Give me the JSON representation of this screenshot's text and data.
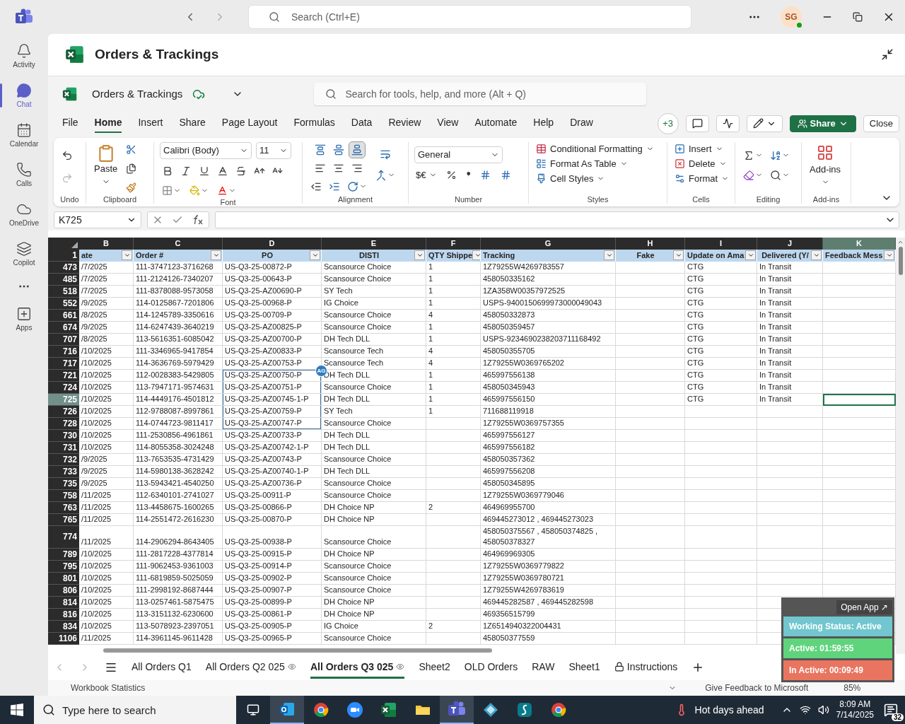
{
  "teams": {
    "search": {
      "placeholder": "Search (Ctrl+E)"
    },
    "avatar": "SG",
    "rail": [
      {
        "label": "Activity",
        "selected": false
      },
      {
        "label": "Chat",
        "selected": true
      },
      {
        "label": "Calendar",
        "selected": false
      },
      {
        "label": "Calls",
        "selected": false
      },
      {
        "label": "OneDrive",
        "selected": false
      },
      {
        "label": "Copilot",
        "selected": false
      },
      {
        "label": "Apps",
        "selected": false
      }
    ]
  },
  "app_title": "Orders & Trackings",
  "workbook": {
    "name": "Orders & Trackings",
    "search": {
      "placeholder": "Search for tools, help, and more (Alt + Q)"
    }
  },
  "menu": [
    {
      "label": "File",
      "selected": false
    },
    {
      "label": "Home",
      "selected": true
    },
    {
      "label": "Insert",
      "selected": false
    },
    {
      "label": "Share",
      "selected": false
    },
    {
      "label": "Page Layout",
      "selected": false
    },
    {
      "label": "Formulas",
      "selected": false
    },
    {
      "label": "Data",
      "selected": false
    },
    {
      "label": "Review",
      "selected": false
    },
    {
      "label": "View",
      "selected": false
    },
    {
      "label": "Automate",
      "selected": false
    },
    {
      "label": "Help",
      "selected": false
    },
    {
      "label": "Draw",
      "selected": false
    }
  ],
  "collaborators_count": "+3",
  "share": "Share",
  "close": "Close",
  "ribbon": {
    "groups": [
      "Undo",
      "Clipboard",
      "Font",
      "Alignment",
      "Number",
      "Styles",
      "Cells",
      "Editing",
      "Add-ins"
    ],
    "paste": "Paste",
    "font": "Calibri (Body)",
    "size": "11",
    "number_format": "General",
    "currency": "$€",
    "styles": [
      "Conditional Formatting",
      "Format As Table",
      "Cell Styles"
    ],
    "cells": [
      "Insert",
      "Delete",
      "Format"
    ],
    "addins": "Add-ins"
  },
  "name_box": "K725",
  "columns": [
    {
      "letter": "B",
      "title": "ate",
      "selected": false
    },
    {
      "letter": "C",
      "title": "Order #",
      "selected": false
    },
    {
      "letter": "D",
      "title": "PO",
      "selected": false
    },
    {
      "letter": "E",
      "title": "DISTI",
      "selected": false
    },
    {
      "letter": "F",
      "title": "QTY Shippe",
      "selected": false
    },
    {
      "letter": "G",
      "title": "Tracking",
      "selected": false
    },
    {
      "letter": "H",
      "title": "Fake",
      "selected": false
    },
    {
      "letter": "I",
      "title": "Update on Ama",
      "selected": false
    },
    {
      "letter": "J",
      "title": "Delivered (Y/",
      "selected": false
    },
    {
      "letter": "K",
      "title": "Feedback Mess",
      "selected": true
    }
  ],
  "header_row": "1",
  "collaborator": {
    "initials": "AG"
  },
  "rows": [
    {
      "row": "473",
      "date": "/7/2025",
      "order": "111-3747123-3716268",
      "po": "US-Q3-25-00872-P",
      "disti": "Scansource Choice",
      "qty": "1",
      "tracking": "1Z79255W4269783557",
      "update": "CTG",
      "delivered": "In Transit",
      "selected": false,
      "po_marked": false
    },
    {
      "row": "485",
      "date": "/7/2025",
      "order": "111-2124126-7340207",
      "po": "US-Q3-25-00643-P",
      "disti": "Scansource Choice",
      "qty": "1",
      "tracking": "458050335162",
      "update": "CTG",
      "delivered": "In Transit",
      "selected": false,
      "po_marked": false
    },
    {
      "row": "518",
      "date": "/7/2025",
      "order": "111-8378088-9573058",
      "po": "US-Q3-25-AZ00690-P",
      "disti": "SY Tech",
      "qty": "1",
      "tracking": "1ZA358W00357972525",
      "update": "CTG",
      "delivered": "In Transit",
      "selected": false,
      "po_marked": false
    },
    {
      "row": "552",
      "date": "/9/2025",
      "order": "114-0125867-7201806",
      "po": "US-Q3-25-00968-P",
      "disti": "IG Choice",
      "qty": "1",
      "tracking": "USPS-9400150699973000049043",
      "update": "CTG",
      "delivered": "In Transit",
      "selected": false,
      "po_marked": false
    },
    {
      "row": "661",
      "date": "/8/2025",
      "order": "114-1245789-3350616",
      "po": "US-Q3-25-00709-P",
      "disti": "Scansource Choice",
      "qty": "4",
      "tracking": "458050332873",
      "update": "CTG",
      "delivered": "In Transit",
      "selected": false,
      "po_marked": false
    },
    {
      "row": "674",
      "date": "/9/2025",
      "order": "114-6247439-3640219",
      "po": "US-Q3-25-AZ00825-P",
      "disti": "Scansource Choice",
      "qty": "1",
      "tracking": "458050359457",
      "update": "CTG",
      "delivered": "In Transit",
      "selected": false,
      "po_marked": false
    },
    {
      "row": "707",
      "date": "/8/2025",
      "order": "113-5616351-6085042",
      "po": "US-Q3-25-AZ00700-P",
      "disti": "DH Tech DLL",
      "qty": "1",
      "tracking": "USPS-9234690238203711168492",
      "update": "CTG",
      "delivered": "In Transit",
      "selected": false,
      "po_marked": false
    },
    {
      "row": "716",
      "date": "/10/2025",
      "order": "111-3346965-9417854",
      "po": "US-Q3-25-AZ00833-P",
      "disti": "Scansource Tech",
      "qty": "4",
      "tracking": "458050355705",
      "update": "CTG",
      "delivered": "In Transit",
      "selected": false,
      "po_marked": false
    },
    {
      "row": "717",
      "date": "/10/2025",
      "order": "114-3636769-5979429",
      "po": "US-Q3-25-AZ00753-P",
      "disti": "Scansource Tech",
      "qty": "4",
      "tracking": "1Z79255W0369765202",
      "update": "CTG",
      "delivered": "In Transit",
      "selected": false,
      "po_marked": false
    },
    {
      "row": "721",
      "date": "/10/2025",
      "order": "112-0028383-5429805",
      "po": "US-Q3-25-AZ00750-P",
      "disti": "DH Tech DLL",
      "qty": "1",
      "tracking": "465997556138",
      "update": "CTG",
      "delivered": "In Transit",
      "selected": false,
      "po_marked": true
    },
    {
      "row": "724",
      "date": "/10/2025",
      "order": "113-7947171-9574631",
      "po": "US-Q3-25-AZ00751-P",
      "disti": "Scansource Choice",
      "qty": "1",
      "tracking": "458050345943",
      "update": "CTG",
      "delivered": "In Transit",
      "selected": false,
      "po_marked": true
    },
    {
      "row": "725",
      "date": "/10/2025",
      "order": "114-4449176-4501812",
      "po": "US-Q3-25-AZ00745-1-P",
      "disti": "DH Tech DLL",
      "qty": "1",
      "tracking": "465997556150",
      "update": "CTG",
      "delivered": "In Transit",
      "selected": true,
      "po_marked": true
    },
    {
      "row": "726",
      "date": "/10/2025",
      "order": "112-9788087-8997861",
      "po": "US-Q3-25-AZ00759-P",
      "disti": "SY Tech",
      "qty": "1",
      "tracking": "711688119918",
      "selected": false,
      "po_marked": true
    },
    {
      "row": "728",
      "date": "/10/2025",
      "order": "114-0744723-9811417",
      "po": "US-Q3-25-AZ00747-P",
      "disti": "Scansource Choice",
      "tracking": "1Z79255W0369757355",
      "selected": false,
      "po_marked": true
    },
    {
      "row": "730",
      "date": "/10/2025",
      "order": "111-2530856-4961861",
      "po": "US-Q3-25-AZ00733-P",
      "disti": "DH Tech DLL",
      "tracking": "465997556127",
      "selected": false,
      "po_marked": false
    },
    {
      "row": "731",
      "date": "/10/2025",
      "order": "114-8055358-3024248",
      "po": "US-Q3-25-AZ00742-1-P",
      "disti": "DH Tech DLL",
      "tracking": "465997556182",
      "selected": false,
      "po_marked": false
    },
    {
      "row": "732",
      "date": "/9/2025",
      "order": "113-7653535-4731429",
      "po": "US-Q3-25-AZ00743-P",
      "disti": "Scansource Choice",
      "tracking": "458050357362",
      "selected": false,
      "po_marked": false
    },
    {
      "row": "733",
      "date": "/9/2025",
      "order": "114-5980138-3628242",
      "po": "US-Q3-25-AZ00740-1-P",
      "disti": "DH Tech DLL",
      "tracking": "465997556208",
      "selected": false,
      "po_marked": false
    },
    {
      "row": "735",
      "date": "/9/2025",
      "order": "113-5943421-4540250",
      "po": "US-Q3-25-AZ00736-P",
      "disti": "Scansource Choice",
      "tracking": "458050345895",
      "selected": false,
      "po_marked": false
    },
    {
      "row": "758",
      "date": "/11/2025",
      "order": "112-6340101-2741027",
      "po": "US-Q3-25-00911-P",
      "disti": "Scansource Choice",
      "tracking": "1Z79255W0369779046",
      "selected": false,
      "po_marked": false
    },
    {
      "row": "763",
      "date": "/11/2025",
      "order": "113-4458675-1600265",
      "po": "US-Q3-25-00866-P",
      "disti": "DH Choice NP",
      "qty": "2",
      "tracking": "464969955700",
      "selected": false,
      "po_marked": false
    },
    {
      "row": "765",
      "date": "/11/2025",
      "order": "114-2551472-2616230",
      "po": "US-Q3-25-00870-P",
      "disti": "DH Choice NP",
      "tracking": "469445273012 , 469445273023",
      "selected": false,
      "po_marked": false
    },
    {
      "row": "774",
      "date": "/11/2025",
      "order": "114-2906294-8643405",
      "po": "US-Q3-25-00938-P",
      "disti": "Scansource Choice",
      "tracking": "458050375567 , 458050374825 , 458050378327",
      "selected": false,
      "po_marked": false
    },
    {
      "row": "789",
      "date": "/10/2025",
      "order": "111-2817228-4377814",
      "po": "US-Q3-25-00915-P",
      "disti": "DH Choice NP",
      "tracking": "464969969305",
      "selected": false,
      "po_marked": false
    },
    {
      "row": "795",
      "date": "/10/2025",
      "order": "111-9062453-9361003",
      "po": "US-Q3-25-00914-P",
      "disti": "Scansource Choice",
      "tracking": "1Z79255W0369779822",
      "selected": false,
      "po_marked": false
    },
    {
      "row": "801",
      "date": "/10/2025",
      "order": "111-6819859-5025059",
      "po": "US-Q3-25-00902-P",
      "disti": "Scansource Choice",
      "tracking": "1Z79255W0369780721",
      "selected": false,
      "po_marked": false
    },
    {
      "row": "806",
      "date": "/10/2025",
      "order": "111-2998192-8687444",
      "po": "US-Q3-25-00907-P",
      "disti": "Scansource Choice",
      "tracking": "1Z79255W4269783619",
      "selected": false,
      "po_marked": false
    },
    {
      "row": "814",
      "date": "/10/2025",
      "order": "113-0257461-5875475",
      "po": "US-Q3-25-00899-P",
      "disti": "DH Choice NP",
      "tracking": "469445282587 , 469445282598",
      "selected": false,
      "po_marked": false
    },
    {
      "row": "816",
      "date": "/10/2025",
      "order": "113-3151132-6230600",
      "po": "US-Q3-25-00861-P",
      "disti": "DH Choice NP",
      "tracking": "469356515799",
      "selected": false,
      "po_marked": false
    },
    {
      "row": "834",
      "date": "/10/2025",
      "order": "113-5078923-2397051",
      "po": "US-Q3-25-00905-P",
      "disti": "IG Choice",
      "qty": "2",
      "tracking": "1Z6514940322004431",
      "selected": false,
      "po_marked": false
    },
    {
      "row": "1106",
      "date": "/11/2025",
      "order": "114-3961145-9611428",
      "po": "US-Q3-25-00965-P",
      "disti": "Scansource Choice",
      "tracking": "458050377559",
      "selected": false,
      "po_marked": false
    }
  ],
  "sheets": [
    {
      "label": "All Orders Q1",
      "selected": false,
      "kind": "plain"
    },
    {
      "label": "All Orders Q2 025",
      "selected": false,
      "kind": "watched"
    },
    {
      "label": "All Orders Q3 025",
      "selected": true,
      "kind": "watched"
    },
    {
      "label": "Sheet2",
      "selected": false,
      "kind": "plain"
    },
    {
      "label": "OLD Orders",
      "selected": false,
      "kind": "plain"
    },
    {
      "label": "RAW",
      "selected": false,
      "kind": "plain"
    },
    {
      "label": "Sheet1",
      "selected": false,
      "kind": "plain"
    },
    {
      "label": "Instructions",
      "selected": false,
      "kind": "locked"
    }
  ],
  "status_bar": {
    "left": "Workbook Statistics",
    "feedback": "Give Feedback to Microsoft",
    "zoom": "85%"
  },
  "widget": {
    "open": "Open App ↗",
    "items": [
      {
        "label": "Working Status: Active",
        "color": "#72c6cf"
      },
      {
        "label": "Active: 01:59:55",
        "color": "#5fd47d"
      },
      {
        "label": "In Active: 00:09:49",
        "color": "#e97560"
      }
    ]
  },
  "taskbar": {
    "search": {
      "placeholder": "Type here to search"
    },
    "apps": [
      {
        "kind": "outlook",
        "active": true
      },
      {
        "kind": "chrome",
        "active": false
      },
      {
        "kind": "zoom",
        "active": false
      },
      {
        "kind": "excel",
        "active": false
      },
      {
        "kind": "folder",
        "active": false
      },
      {
        "kind": "teams",
        "active": true
      },
      {
        "kind": "diamond",
        "active": false
      },
      {
        "kind": "script",
        "active": false
      },
      {
        "kind": "chrome",
        "active": false
      }
    ],
    "weather": "Hot days ahead",
    "time": "8:09 AM",
    "date": "7/14/2025",
    "notifications": "32"
  }
}
